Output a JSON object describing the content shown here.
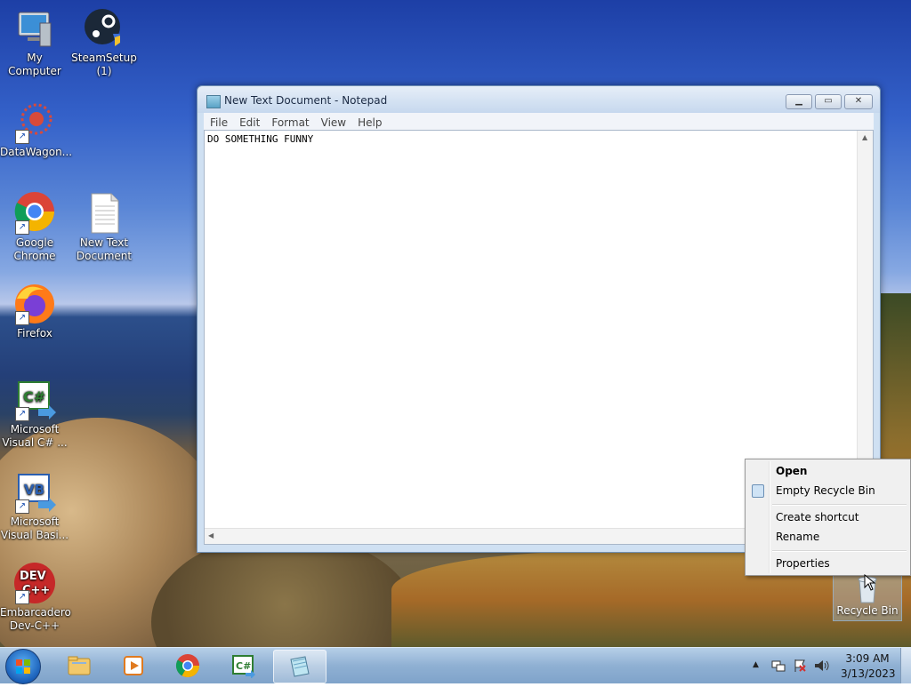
{
  "desktop": {
    "icons": [
      {
        "label": "My Computer",
        "icon": "computer-icon"
      },
      {
        "label": "SteamSetup (1)",
        "icon": "steam-icon"
      },
      {
        "label": "DataWagon...",
        "icon": "datawagon-icon"
      },
      {
        "label": "Google Chrome",
        "icon": "chrome-icon"
      },
      {
        "label": "New Text Document",
        "icon": "text-file-icon"
      },
      {
        "label": "Firefox",
        "icon": "firefox-icon"
      },
      {
        "label": "Microsoft Visual C# ...",
        "icon": "visual-csharp-icon"
      },
      {
        "label": "Microsoft Visual Basi...",
        "icon": "visual-basic-icon"
      },
      {
        "label": "Embarcadero Dev-C++",
        "icon": "devcpp-icon"
      }
    ],
    "recycle_bin": {
      "label": "Recycle Bin",
      "icon": "recycle-bin-icon"
    }
  },
  "notepad": {
    "title": "New Text Document - Notepad",
    "menu": [
      "File",
      "Edit",
      "Format",
      "View",
      "Help"
    ],
    "content": "DO SOMETHING FUNNY",
    "buttons": {
      "minimize": "▁",
      "maximize": "▭",
      "close": "✕"
    }
  },
  "context_menu": {
    "items": [
      {
        "label": "Open",
        "bold": true
      },
      {
        "label": "Empty Recycle Bin",
        "icon": "recycle-bin-icon"
      },
      {
        "label": "Create shortcut"
      },
      {
        "label": "Rename"
      },
      {
        "label": "Properties"
      }
    ]
  },
  "taskbar": {
    "pinned": [
      {
        "name": "windows-explorer",
        "icon": "folder-icon"
      },
      {
        "name": "media-player",
        "icon": "media-player-icon"
      },
      {
        "name": "chrome",
        "icon": "chrome-icon"
      },
      {
        "name": "visual-csharp",
        "icon": "visual-csharp-icon"
      },
      {
        "name": "notepad",
        "icon": "notepad-icon",
        "active": true
      }
    ],
    "tray": {
      "show_hidden": "▲"
    },
    "clock": {
      "time": "3:09 AM",
      "date": "3/13/2023"
    }
  }
}
